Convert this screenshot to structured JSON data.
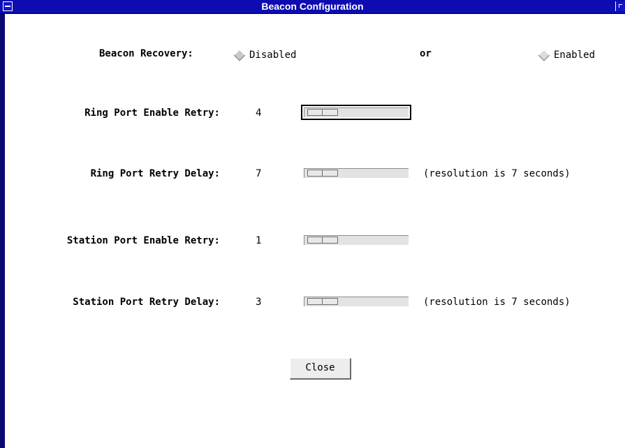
{
  "window": {
    "title": "Beacon Configuration"
  },
  "beacon_recovery": {
    "label": "Beacon Recovery:",
    "disabled_label": "Disabled",
    "or_label": "or",
    "enabled_label": "Enabled"
  },
  "rows": [
    {
      "label": "Ring Port Enable Retry:",
      "value": "4",
      "note": "",
      "slider_fraction": 0.0
    },
    {
      "label": "Ring Port Retry Delay:",
      "value": "7",
      "note": "(resolution is 7 seconds)",
      "slider_fraction": 0.0
    },
    {
      "label": "Station Port Enable Retry:",
      "value": "1",
      "note": "",
      "slider_fraction": 0.0
    },
    {
      "label": "Station Port Retry Delay:",
      "value": "3",
      "note": "(resolution is 7 seconds)",
      "slider_fraction": 0.0
    }
  ],
  "buttons": {
    "close_label": "Close"
  },
  "colors": {
    "titlebar": "#0c0cb0",
    "window_frame": "#0a0a6e",
    "background": "#ffffff"
  }
}
